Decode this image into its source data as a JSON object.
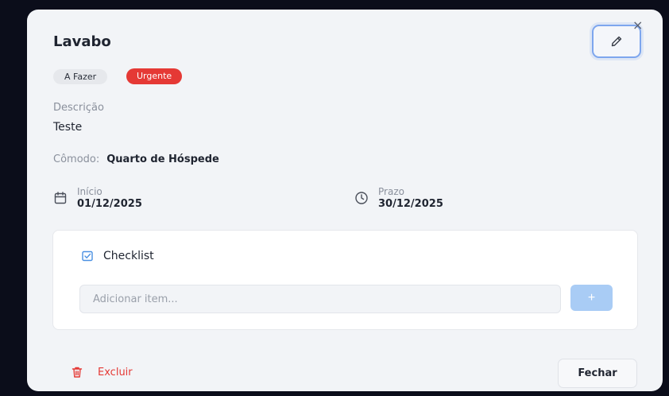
{
  "task": {
    "title": "Lavabo",
    "status": "A Fazer",
    "priority": "Urgente",
    "description_label": "Descrição",
    "description": "Teste",
    "room_label": "Cômodo:",
    "room": "Quarto de Hóspede",
    "start_label": "Início",
    "start_date": "01/12/2025",
    "due_label": "Prazo",
    "due_date": "30/12/2025"
  },
  "checklist": {
    "title": "Checklist",
    "input_placeholder": "Adicionar item...",
    "input_value": "",
    "add_label": "+"
  },
  "actions": {
    "close_x": "×",
    "delete_label": "Excluir",
    "close_label": "Fechar"
  },
  "colors": {
    "accent": "#7da6ee",
    "danger": "#e53935",
    "add_button": "#a9ccf5",
    "background": "#f2f4f7"
  },
  "icons": {
    "edit": "pencil-icon",
    "close": "close-icon",
    "start": "calendar-icon",
    "due": "clock-icon",
    "checklist": "checkbox-icon",
    "delete": "trash-icon"
  }
}
